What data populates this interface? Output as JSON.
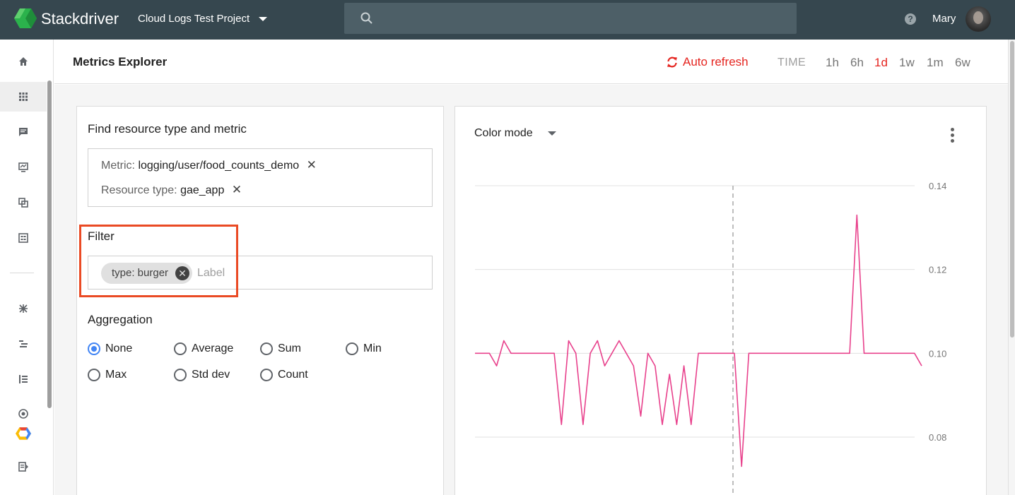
{
  "topbar": {
    "brand": "Stackdriver",
    "project": "Cloud Logs Test Project",
    "help_icon": "?",
    "user": "Mary"
  },
  "nav": {
    "icons": [
      "home-icon",
      "dashboard-grid-icon",
      "logs-icon",
      "monitoring-icon",
      "resources-icon",
      "table-icon",
      "debug-icon",
      "trace-icon",
      "profiler-icon",
      "uptime-icon",
      "gcp-icon",
      "export-icon"
    ]
  },
  "header": {
    "title": "Metrics Explorer",
    "auto_refresh": "Auto refresh",
    "time_label": "TIME",
    "time_options": [
      "1h",
      "6h",
      "1d",
      "1w",
      "1m",
      "6w"
    ],
    "selected_time": "1d"
  },
  "find": {
    "title": "Find resource type and metric",
    "metric_label": "Metric:",
    "metric_value": "logging/user/food_counts_demo",
    "resource_label": "Resource type:",
    "resource_value": "gae_app",
    "remove_glyph": "✕"
  },
  "filter": {
    "title": "Filter",
    "chip": "type: burger",
    "chip_remove_glyph": "✕",
    "input_placeholder": "Label"
  },
  "aggregation": {
    "title": "Aggregation",
    "options": [
      "None",
      "Average",
      "Sum",
      "Min",
      "Max",
      "Std dev",
      "Count"
    ],
    "selected": "None"
  },
  "chart": {
    "color_mode_label": "Color mode",
    "line_color": "#e8418c",
    "y_ticks": [
      "0.14",
      "0.12",
      "0.10",
      "0.08"
    ]
  },
  "chart_data": {
    "type": "line",
    "ylim": [
      0.07,
      0.14
    ],
    "series": [
      {
        "values": [
          0.1,
          0.1,
          0.1,
          0.097,
          0.103,
          0.1,
          0.1,
          0.1,
          0.1,
          0.1,
          0.1,
          0.1,
          0.083,
          0.103,
          0.1,
          0.083,
          0.1,
          0.103,
          0.097,
          0.1,
          0.103,
          0.1,
          0.097,
          0.085,
          0.1,
          0.097,
          0.083,
          0.095,
          0.083,
          0.097,
          0.083,
          0.1,
          0.1,
          0.1,
          0.1,
          0.1,
          0.1,
          0.073,
          0.1,
          0.1,
          0.1,
          0.1,
          0.1,
          0.1,
          0.1,
          0.1,
          0.1,
          0.1,
          0.1,
          0.1,
          0.1,
          0.1,
          0.1,
          0.133,
          0.1,
          0.1,
          0.1,
          0.1,
          0.1,
          0.1,
          0.1,
          0.1,
          0.097
        ]
      }
    ]
  }
}
